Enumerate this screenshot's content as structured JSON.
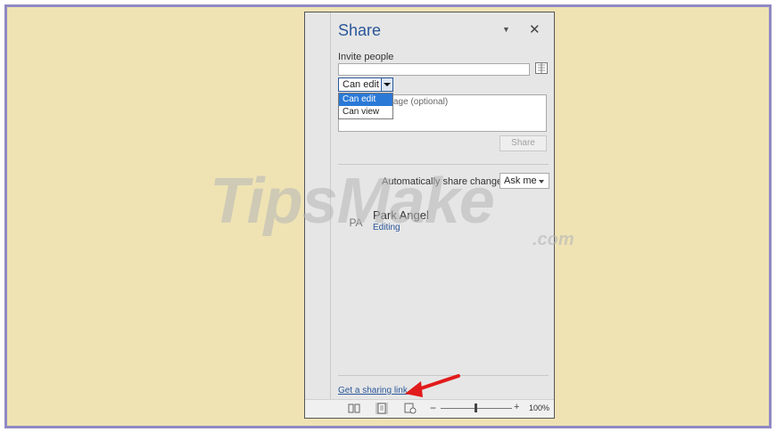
{
  "pane": {
    "title": "Share",
    "invite_label": "Invite people",
    "permission_value": "Can edit",
    "permission_options": [
      "Can edit",
      "Can view"
    ],
    "message_placeholder": "age (optional)",
    "share_button": "Share",
    "auto_share_label": "Automatically share changes:",
    "auto_share_value": "Ask me",
    "user": {
      "initials": "PA",
      "name": "Park Angel",
      "role": "Editing"
    },
    "sharing_link": "Get a sharing link"
  },
  "statusbar": {
    "zoom_minus": "−",
    "zoom_plus": "+",
    "zoom_percent": "100%"
  },
  "watermark": {
    "main": "TipsMake",
    "suffix": ".com"
  },
  "colors": {
    "accent": "#2b579a",
    "background": "#efe3b4",
    "frame": "#8f89c2",
    "annotation": "#e11b1b"
  }
}
